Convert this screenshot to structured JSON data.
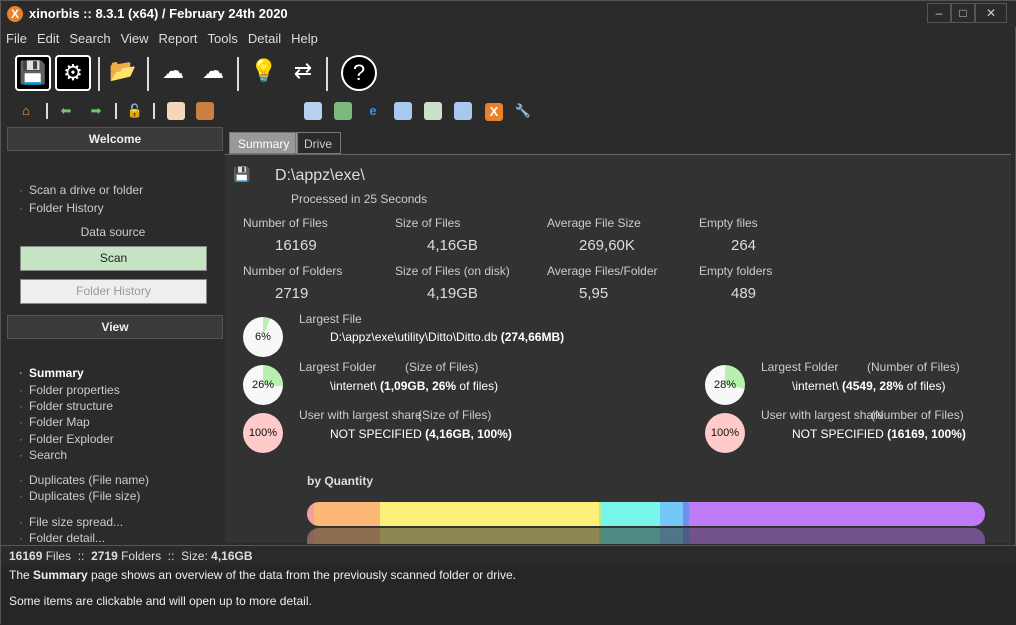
{
  "window": {
    "title": "xinorbis :: 8.3.1 (x64) / February 24th 2020",
    "logo": "X",
    "controls": [
      "minimize",
      "maximize",
      "close"
    ]
  },
  "menu": [
    "File",
    "Edit",
    "Search",
    "View",
    "Report",
    "Tools",
    "Detail",
    "Help"
  ],
  "toolbar_big": [
    "save-icon",
    "scan-settings-icon",
    "open-folder-icon",
    "cloud-upload-icon",
    "cloud-search-icon",
    "lightbulb-icon",
    "swap-icon",
    "help-icon"
  ],
  "toolbar_small": [
    "home-icon",
    "back-icon",
    "forward-icon",
    "lock-icon",
    "database-icon",
    "network-icon",
    "table-icon",
    "excel-icon",
    "ie-icon",
    "word-icon",
    "tree-icon",
    "xml-icon",
    "xinorbis-icon",
    "wrench-icon"
  ],
  "sidebar": {
    "welcome_header": "Welcome",
    "welcome_items": [
      "Scan a drive or folder",
      "Folder History"
    ],
    "data_source_label": "Data source",
    "scan_button": "Scan",
    "history_button": "Folder History",
    "view_header": "View",
    "view_items": [
      "Summary",
      "Folder properties",
      "Folder structure",
      "Folder Map",
      "Folder Exploder",
      "Search",
      "Duplicates (File name)",
      "Duplicates (File size)",
      "File size spread...",
      "Folder detail..."
    ]
  },
  "tabs": [
    {
      "label": "Summary",
      "active": true
    },
    {
      "label": "Drive",
      "active": false
    }
  ],
  "summary": {
    "path": "D:\\appz\\exe\\",
    "processed": "Processed in 25 Seconds",
    "stats": [
      {
        "label": "Number of Files",
        "value": "16169"
      },
      {
        "label": "Size of Files",
        "value": "4,16GB"
      },
      {
        "label": "Average File Size",
        "value": "269,60K"
      },
      {
        "label": "Empty files",
        "value": "264"
      },
      {
        "label": "Number of Folders",
        "value": "2719"
      },
      {
        "label": "Size of Files (on disk)",
        "value": "4,19GB"
      },
      {
        "label": "Average Files/Folder",
        "value": "5,95"
      },
      {
        "label": "Empty folders",
        "value": "489"
      }
    ],
    "largest_file": {
      "pct": 6,
      "pct_label": "6%",
      "label": "Largest File",
      "path": "D:\\appz\\exe\\utility\\Ditto\\Ditto.db",
      "detail": "(274,66MB)"
    },
    "largest_folder_size": {
      "pct": 26,
      "pct_label": "26%",
      "label": "Largest Folder",
      "qualifier": "(Size of Files)",
      "name": "\\internet\\",
      "detail": "(1,09GB, 26%",
      "suffix": " of files)"
    },
    "largest_folder_count": {
      "pct": 28,
      "pct_label": "28%",
      "label": "Largest Folder",
      "qualifier": "(Number of Files)",
      "name": "\\internet\\",
      "detail": "(4549, 28%",
      "suffix": " of files)"
    },
    "user_size": {
      "pct": 100,
      "pct_label": "100%",
      "label": "User with largest share",
      "qualifier": "(Size of Files)",
      "name": "NOT SPECIFIED",
      "detail": "(4,16GB, 100%)"
    },
    "user_count": {
      "pct": 100,
      "pct_label": "100%",
      "label": "User with largest share",
      "qualifier": "(Number of Files)",
      "name": "NOT SPECIFIED",
      "detail": "(16169, 100%)"
    },
    "quantity_title": "by Quantity",
    "quantity_segments": [
      {
        "color": "#f4a0a0",
        "share": 1.0
      },
      {
        "color": "#fdb776",
        "share": 9.7
      },
      {
        "color": "#fdf07a",
        "share": 32.3
      },
      {
        "color": "#b4f08a",
        "share": 0.3
      },
      {
        "color": "#76f5e8",
        "share": 8.8
      },
      {
        "color": "#74c8f8",
        "share": 3.4
      },
      {
        "color": "#7090f0",
        "share": 0.9
      },
      {
        "color": "#bf7af8",
        "share": 43.6
      }
    ]
  },
  "status": {
    "files": "16169",
    "files_label": " Files  ::  ",
    "folders": "2719",
    "folders_label": " Folders  ::  Size: ",
    "size": "4,16GB"
  },
  "help": {
    "pre": "The ",
    "bold": "Summary",
    "post": " page shows an overview of the data from the previously scanned folder or drive.",
    "line2": "Some items are clickable and will open up to more detail."
  }
}
